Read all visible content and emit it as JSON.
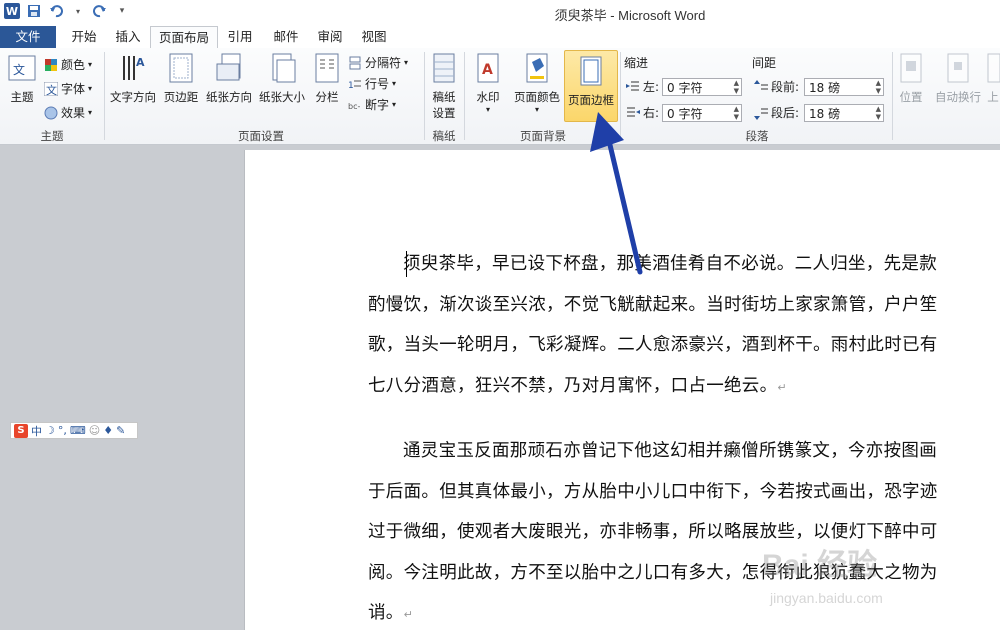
{
  "window": {
    "title": "须臾茶毕 - Microsoft Word"
  },
  "tabs": [
    {
      "label": "文件"
    },
    {
      "label": "开始"
    },
    {
      "label": "插入"
    },
    {
      "label": "页面布局"
    },
    {
      "label": "引用"
    },
    {
      "label": "邮件"
    },
    {
      "label": "审阅"
    },
    {
      "label": "视图"
    }
  ],
  "ribbon": {
    "theme": {
      "group": "主题",
      "themes": "主题",
      "colors": "颜色",
      "fonts": "字体",
      "effects": "效果"
    },
    "page_setup": {
      "group": "页面设置",
      "text_direction": "文字方向",
      "margins": "页边距",
      "orientation": "纸张方向",
      "size": "纸张大小",
      "columns": "分栏",
      "breaks": "分隔符",
      "line_numbers": "行号",
      "hyphenation": "断字"
    },
    "draft": {
      "group": "稿纸",
      "label": "稿纸\n设置",
      "line1": "稿纸",
      "line2": "设置"
    },
    "page_background": {
      "group": "页面背景",
      "watermark": "水印",
      "page_color": "页面颜色",
      "page_borders": "页面边框"
    },
    "paragraph": {
      "group": "段落",
      "indent": "缩进",
      "spacing": "间距",
      "left_label": "左:",
      "left_value": "0 字符",
      "right_label": "右:",
      "right_value": "0 字符",
      "before_label": "段前:",
      "before_value": "18 磅",
      "after_label": "段后:",
      "after_value": "18 磅"
    },
    "arrange": {
      "position": "位置",
      "wrap_text": "自动换行",
      "more": "上"
    }
  },
  "document": {
    "para1": "须臾茶毕，早已设下杯盘，那美酒佳肴自不必说。二人归坐，先是款酌慢饮，渐次谈至兴浓，不觉飞觥献起来。当时街坊上家家箫管，户户笙歌，当头一轮明月，飞彩凝辉。二人愈添豪兴，酒到杯干。雨村此时已有七八分酒意，狂兴不禁，乃对月寓怀，口占一绝云。",
    "para2": "通灵宝玉反面那顽石亦曾记下他这幻相并癞僧所镌篆文，今亦按图画于后面。但其真体最小，方从胎中小儿口中衔下，今若按式画出，恐字迹过于微细，使观者大废眼光，亦非畅事，所以略展放些，以便灯下醉中可阅。今注明此故，方不至以胎中之儿口有多大，怎得衔此狼犺蠢大之物为诮。",
    "para_mark": "↵"
  },
  "ime": {
    "logo": "S",
    "mode": "中"
  },
  "watermark": {
    "brand": "Bai 经验",
    "url": "jingyan.baidu.com"
  },
  "colors": {
    "file_tab": "#2b5797",
    "arrow": "#1f3fa8",
    "highlight": "#fbd66a"
  }
}
